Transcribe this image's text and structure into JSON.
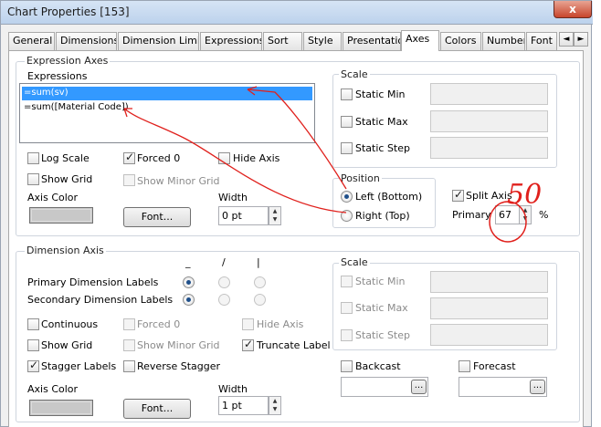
{
  "window": {
    "title": "Chart Properties [153]",
    "close_label": "x"
  },
  "tabs": [
    "General",
    "Dimensions",
    "Dimension Limits",
    "Expressions",
    "Sort",
    "Style",
    "Presentation",
    "Axes",
    "Colors",
    "Number",
    "Font"
  ],
  "tab_scroll": [
    "◄",
    "►"
  ],
  "active_tab": "Axes",
  "expression_axes": {
    "group_label": "Expression Axes",
    "list_label": "Expressions",
    "expressions": [
      {
        "text": "=sum(sv)",
        "selected": true
      },
      {
        "text": "=sum([Material Code])",
        "selected": false
      }
    ],
    "log_scale": {
      "label": "Log Scale",
      "checked": false
    },
    "forced_0": {
      "label": "Forced 0",
      "checked": true
    },
    "hide_axis": {
      "label": "Hide Axis",
      "checked": false
    },
    "show_grid": {
      "label": "Show Grid",
      "checked": false
    },
    "show_minor_grid": {
      "label": "Show Minor Grid",
      "checked": false,
      "disabled": true
    },
    "axis_color_label": "Axis Color",
    "font_button": "Font...",
    "width_label": "Width",
    "width_value": "0 pt",
    "scale": {
      "label": "Scale",
      "static_min": "Static Min",
      "static_max": "Static Max",
      "static_step": "Static Step"
    },
    "position": {
      "label": "Position",
      "left_bottom": "Left (Bottom)",
      "right_top": "Right (Top)",
      "selected": "left_bottom"
    },
    "split_axis": {
      "label": "Split Axis",
      "checked": true
    },
    "primary_label": "Primary",
    "primary_value": "67",
    "percent": "%"
  },
  "annotation": {
    "text": "50",
    "color": "#e0201c"
  },
  "dimension_axis": {
    "group_label": "Dimension Axis",
    "orientation_headers": [
      "_",
      "/",
      "|"
    ],
    "primary_labels": "Primary Dimension Labels",
    "secondary_labels": "Secondary Dimension Labels",
    "continuous": {
      "label": "Continuous",
      "checked": false
    },
    "forced_0": {
      "label": "Forced 0",
      "checked": false,
      "disabled": true
    },
    "hide_axis": {
      "label": "Hide Axis",
      "checked": false,
      "disabled": true
    },
    "show_grid": {
      "label": "Show Grid",
      "checked": false
    },
    "show_minor_grid": {
      "label": "Show Minor Grid",
      "checked": false,
      "disabled": true
    },
    "truncate_label": {
      "label": "Truncate Label",
      "checked": true
    },
    "stagger_labels": {
      "label": "Stagger Labels",
      "checked": true
    },
    "reverse_stagger": {
      "label": "Reverse Stagger",
      "checked": false
    },
    "axis_color_label": "Axis Color",
    "font_button": "Font...",
    "width_label": "Width",
    "width_value": "1 pt",
    "scale": {
      "label": "Scale",
      "static_min": "Static Min",
      "static_max": "Static Max",
      "static_step": "Static Step"
    },
    "backcast": {
      "label": "Backcast",
      "checked": false
    },
    "forecast": {
      "label": "Forecast",
      "checked": false
    },
    "browse_button": "..."
  }
}
